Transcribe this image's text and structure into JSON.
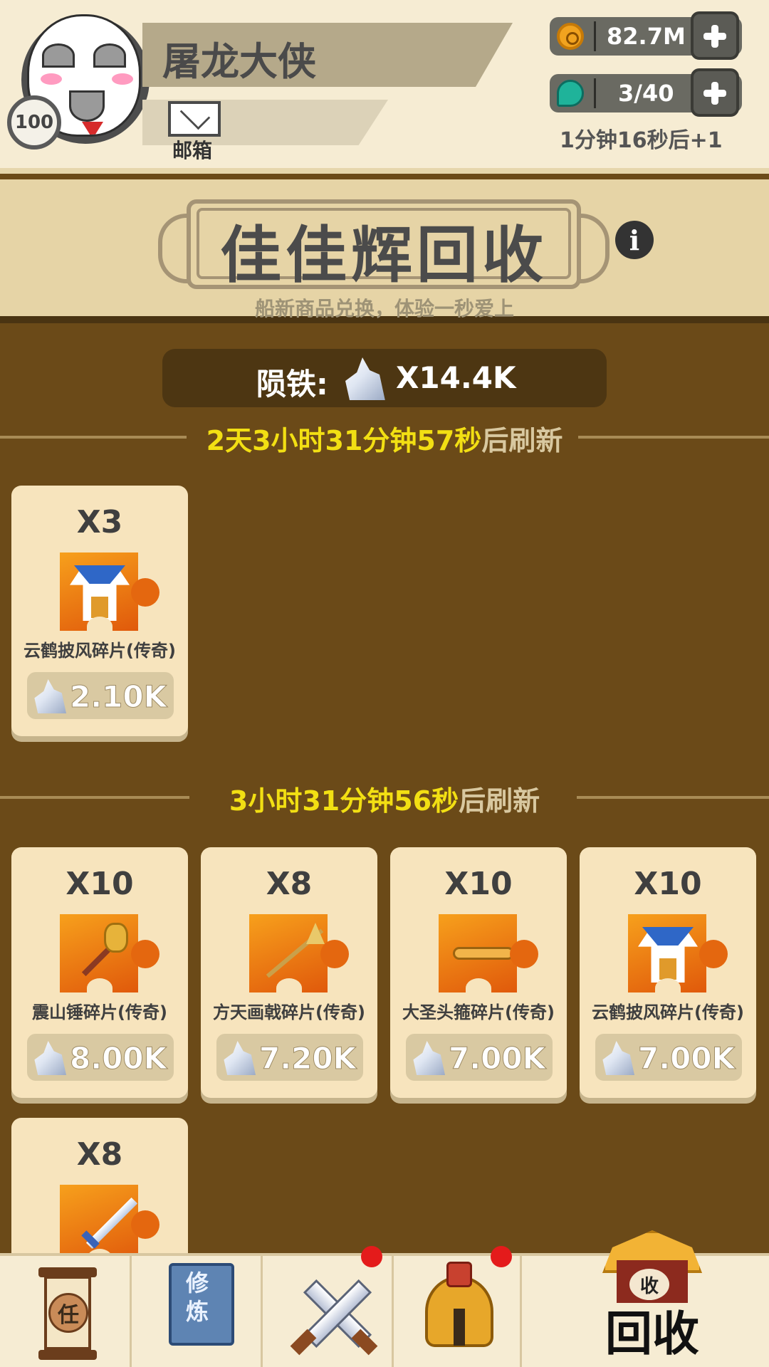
{
  "player": {
    "name": "屠龙大侠",
    "level": "100",
    "mail_label": "邮箱"
  },
  "resources": {
    "coins": "82.7M",
    "energy": "3/40",
    "energy_regen": "1分钟16秒后+1"
  },
  "shop": {
    "title": "佳佳辉回收",
    "subtitle": "船新商品兑换，体验一秒爱上",
    "balance_label": "陨铁:",
    "balance_value": "X14.4K"
  },
  "sections": [
    {
      "refresh_time": "2天3小时31分钟57秒",
      "refresh_suffix": "后刷新",
      "items": [
        {
          "qty": "X3",
          "name": "云鹤披风碎片(传奇)",
          "price": "2.10K",
          "art": "robe-icon"
        }
      ]
    },
    {
      "refresh_time": "3小时31分钟56秒",
      "refresh_suffix": "后刷新",
      "items": [
        {
          "qty": "X10",
          "name": "震山锤碎片(传奇)",
          "price": "8.00K",
          "art": "hammer-icon"
        },
        {
          "qty": "X8",
          "name": "方天画戟碎片(传奇)",
          "price": "7.20K",
          "art": "spear-icon"
        },
        {
          "qty": "X10",
          "name": "大圣头箍碎片(传奇)",
          "price": "7.00K",
          "art": "headband-icon"
        },
        {
          "qty": "X10",
          "name": "云鹤披风碎片(传奇)",
          "price": "7.00K",
          "art": "robe-icon"
        },
        {
          "qty": "X8",
          "name": "",
          "price": "",
          "art": "sword-icon"
        }
      ]
    }
  ],
  "bottom_nav": {
    "task_glyph": "任",
    "cultivate_glyph": "修炼",
    "recycle_badge": "收",
    "recycle_label": "回收"
  },
  "colors": {
    "background": "#6b4a18",
    "panel": "#f6ecd3",
    "card": "#f7e4bd",
    "refresh_highlight": "#f2df13",
    "notification": "#e41b1b"
  }
}
